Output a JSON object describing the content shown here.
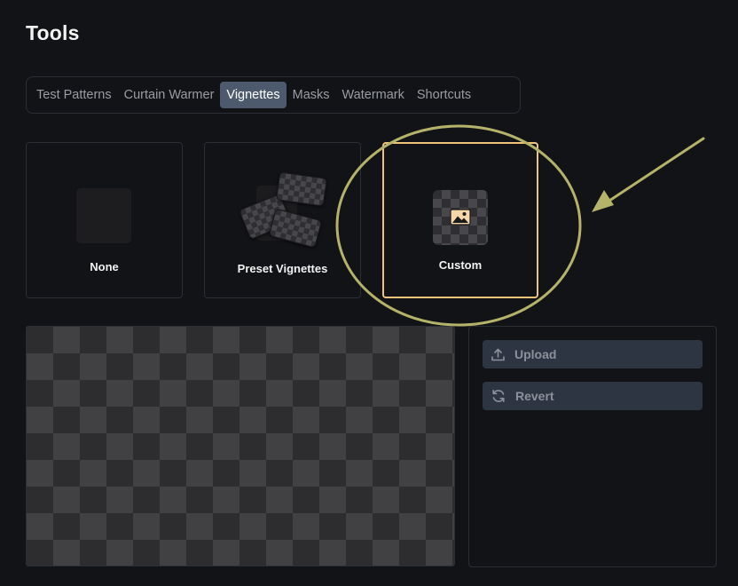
{
  "page": {
    "title": "Tools"
  },
  "tabs": [
    {
      "label": "Test Patterns",
      "active": false
    },
    {
      "label": "Curtain Warmer",
      "active": false
    },
    {
      "label": "Vignettes",
      "active": true
    },
    {
      "label": "Masks",
      "active": false
    },
    {
      "label": "Watermark",
      "active": false
    },
    {
      "label": "Shortcuts",
      "active": false
    }
  ],
  "vignette_options": {
    "none": {
      "label": "None"
    },
    "preset": {
      "label": "Preset Vignettes"
    },
    "custom": {
      "label": "Custom",
      "selected": true
    }
  },
  "actions": {
    "upload_label": "Upload",
    "revert_label": "Revert"
  },
  "colors": {
    "background": "#121317",
    "active_tab": "#4d596c",
    "selected_border": "#f0c37a",
    "annotation": "#b5b26a",
    "button_bg": "#2e3542"
  },
  "icons": {
    "custom": "image-icon",
    "upload": "upload-icon",
    "revert": "refresh-icon"
  }
}
